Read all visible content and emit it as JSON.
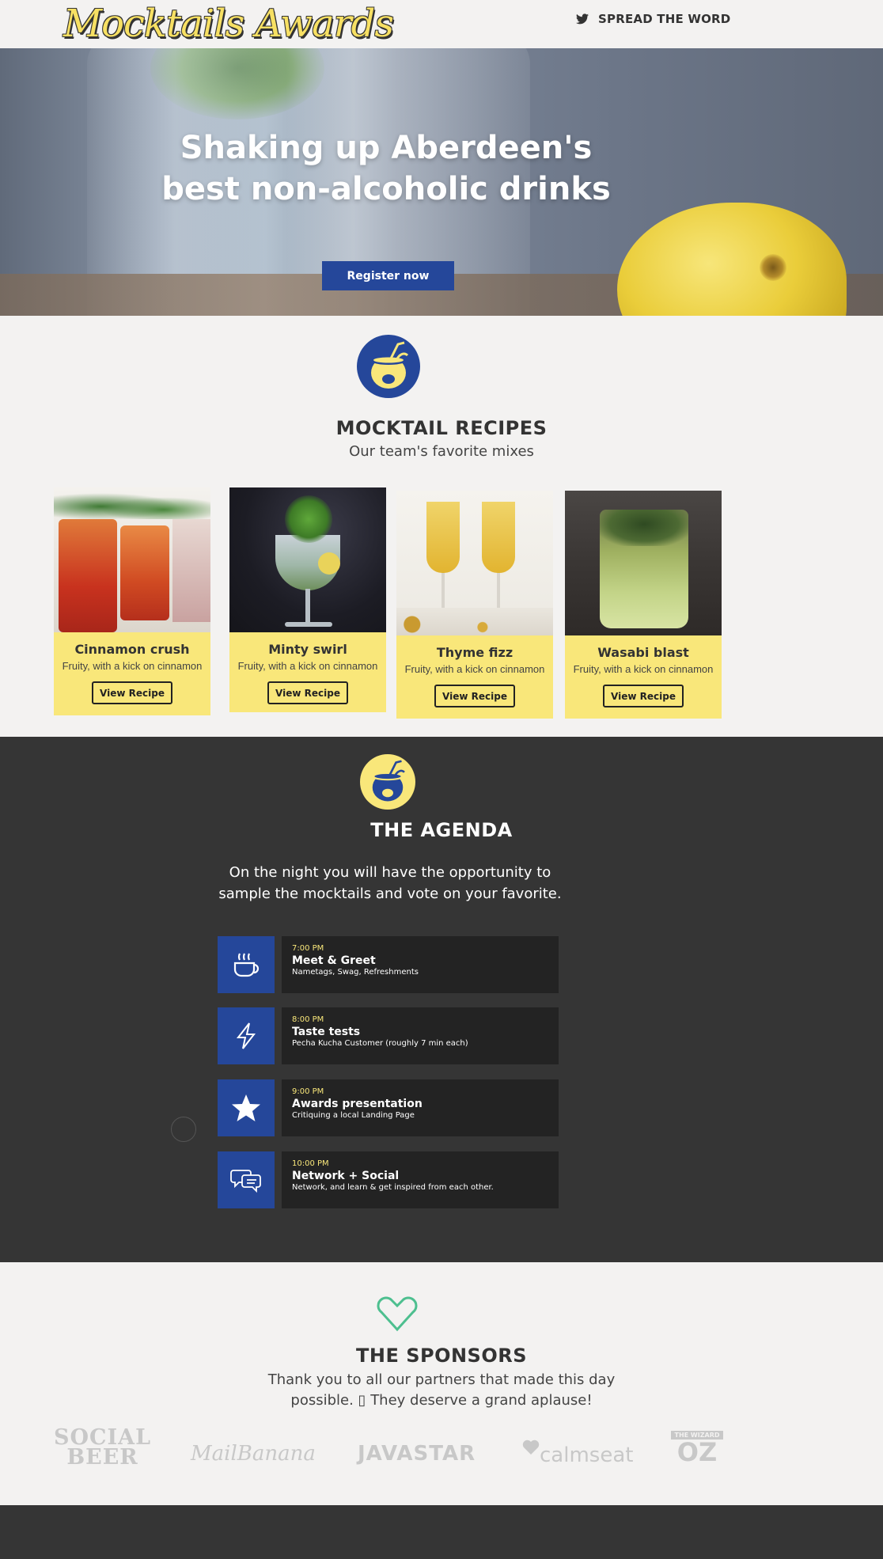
{
  "header": {
    "logo": "Mocktails Awards",
    "share_label": "SPREAD THE WORD",
    "share_icon": "twitter-icon"
  },
  "hero": {
    "headline_line1": "Shaking up Aberdeen's",
    "headline_line2": "best non-alcoholic drinks",
    "cta": "Register now"
  },
  "recipes": {
    "icon": "coconut-drink-icon",
    "title": "MOCKTAIL RECIPES",
    "subtitle": "Our team's favorite mixes",
    "cards": [
      {
        "name": "Cinnamon crush",
        "desc": "Fruity, with a kick on cinnamon",
        "button": "View Recipe"
      },
      {
        "name": "Minty swirl",
        "desc": "Fruity, with a kick on cinnamon",
        "button": "View Recipe"
      },
      {
        "name": "Thyme fizz",
        "desc": "Fruity, with a kick on cinnamon",
        "button": "View Recipe"
      },
      {
        "name": "Wasabi blast",
        "desc": "Fruity, with a kick on cinnamon",
        "button": "View Recipe"
      }
    ]
  },
  "agenda": {
    "icon": "coconut-drink-icon",
    "title": "THE AGENDA",
    "lead": "On the night you will have the opportunity to sample the mocktails and vote on your favorite.",
    "items": [
      {
        "icon": "coffee-cup-icon",
        "time": "7:00 PM",
        "title": "Meet & Greet",
        "sub": "Nametags, Swag, Refreshments"
      },
      {
        "icon": "lightning-icon",
        "time": "8:00 PM",
        "title": "Taste tests",
        "sub": "Pecha Kucha Customer (roughly 7 min each)"
      },
      {
        "icon": "star-icon",
        "time": "9:00 PM",
        "title": "Awards presentation",
        "sub": "Critiquing a local Landing Page"
      },
      {
        "icon": "chat-bubbles-icon",
        "time": "10:00 PM",
        "title": "Network + Social",
        "sub": "Network, and learn & get inspired from each other."
      }
    ]
  },
  "sponsors": {
    "icon": "heart-icon",
    "title": "THE SPONSORS",
    "line1": "Thank you to all our partners that made this day",
    "line2": "possible. ▯ They deserve a grand aplause!",
    "logos": {
      "social_beer_1": "SOCIAL",
      "social_beer_2": "BEER",
      "mailbanana": "MailBanana",
      "javastar": "JAVASTAR",
      "calmseat": "calmseat",
      "wizard_top": "THE WIZARD",
      "wizard_oz": "OZ"
    }
  },
  "colors": {
    "brand_blue": "#25479a",
    "brand_yellow": "#f9e77a",
    "dark": "#353535",
    "teal": "#4dbf8f"
  }
}
